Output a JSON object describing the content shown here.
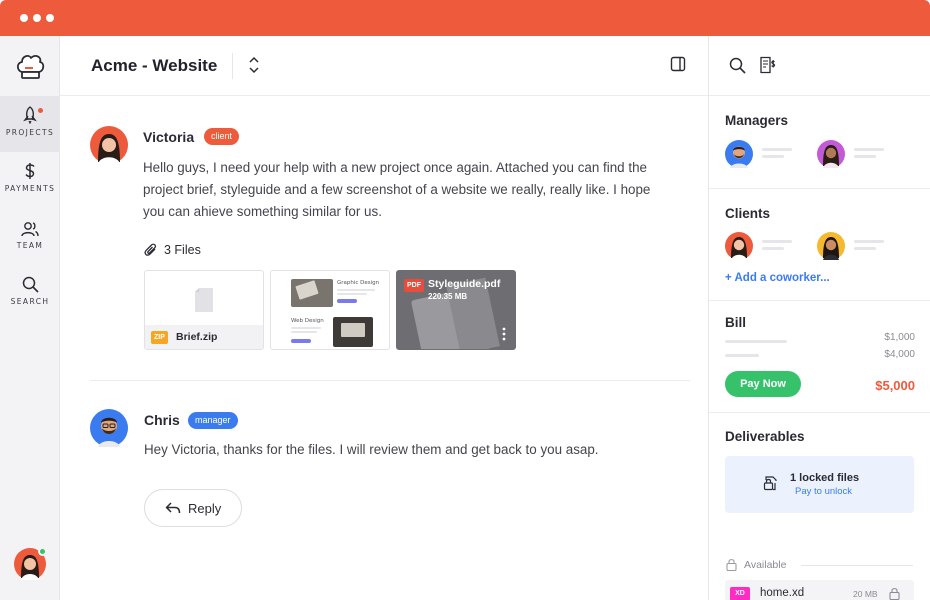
{
  "window": {
    "controls": [
      "close",
      "minimize",
      "maximize"
    ]
  },
  "colors": {
    "accent": "#ee5a3c",
    "client_badge": "#ee5a3c",
    "manager_badge": "#3a7cf0",
    "success": "#36c26b",
    "link": "#3a7cf0",
    "xd": "#ff2bc2",
    "zip": "#f5a623",
    "pdf": "#e74c3c"
  },
  "sidebar": {
    "logo_icon": "chef-hat-icon",
    "items": [
      {
        "label": "PROJECTS",
        "icon": "rocket-icon",
        "active": true,
        "has_notification": true
      },
      {
        "label": "PAYMENTS",
        "icon": "dollar-icon"
      },
      {
        "label": "TEAM",
        "icon": "users-icon"
      },
      {
        "label": "SEARCH",
        "icon": "search-icon"
      }
    ],
    "user_online": true
  },
  "header": {
    "title": "Acme - Website"
  },
  "messages": [
    {
      "author": "Victoria",
      "badge": "client",
      "lines": [
        "Hello guys, I need your help with a new project once again. Attached you can find the",
        "project brief, styleguide and a few screenshot of a website we really, really like. I hope",
        "you can ahieve something similar for us."
      ],
      "files_label": "3 Files",
      "files": [
        {
          "type": "ZIP",
          "name": "Brief.zip"
        },
        {
          "type": "image",
          "name": "website screenshot",
          "lines": [
            "Graphic Design",
            "Web Design"
          ]
        },
        {
          "type": "PDF",
          "name": "Styleguide.pdf",
          "size": "220.35 MB"
        }
      ]
    },
    {
      "author": "Chris",
      "badge": "manager",
      "lines": [
        "Hey Victoria, thanks for the files. I will review them and get back to you asap."
      ]
    }
  ],
  "reply": {
    "label": "Reply"
  },
  "right_panel": {
    "managers": {
      "title": "Managers"
    },
    "clients": {
      "title": "Clients",
      "add_link": "+ Add a coworker..."
    },
    "bill": {
      "title": "Bill",
      "amounts": [
        "$1,000",
        "$4,000"
      ],
      "pay_label": "Pay Now",
      "total": "$5,000"
    },
    "deliverables": {
      "title": "Deliverables",
      "locked_title": "1 locked files",
      "locked_link": "Pay to unlock",
      "available_label": "Available",
      "file": {
        "type": "XD",
        "name": "home.xd",
        "size": "20 MB"
      }
    }
  }
}
